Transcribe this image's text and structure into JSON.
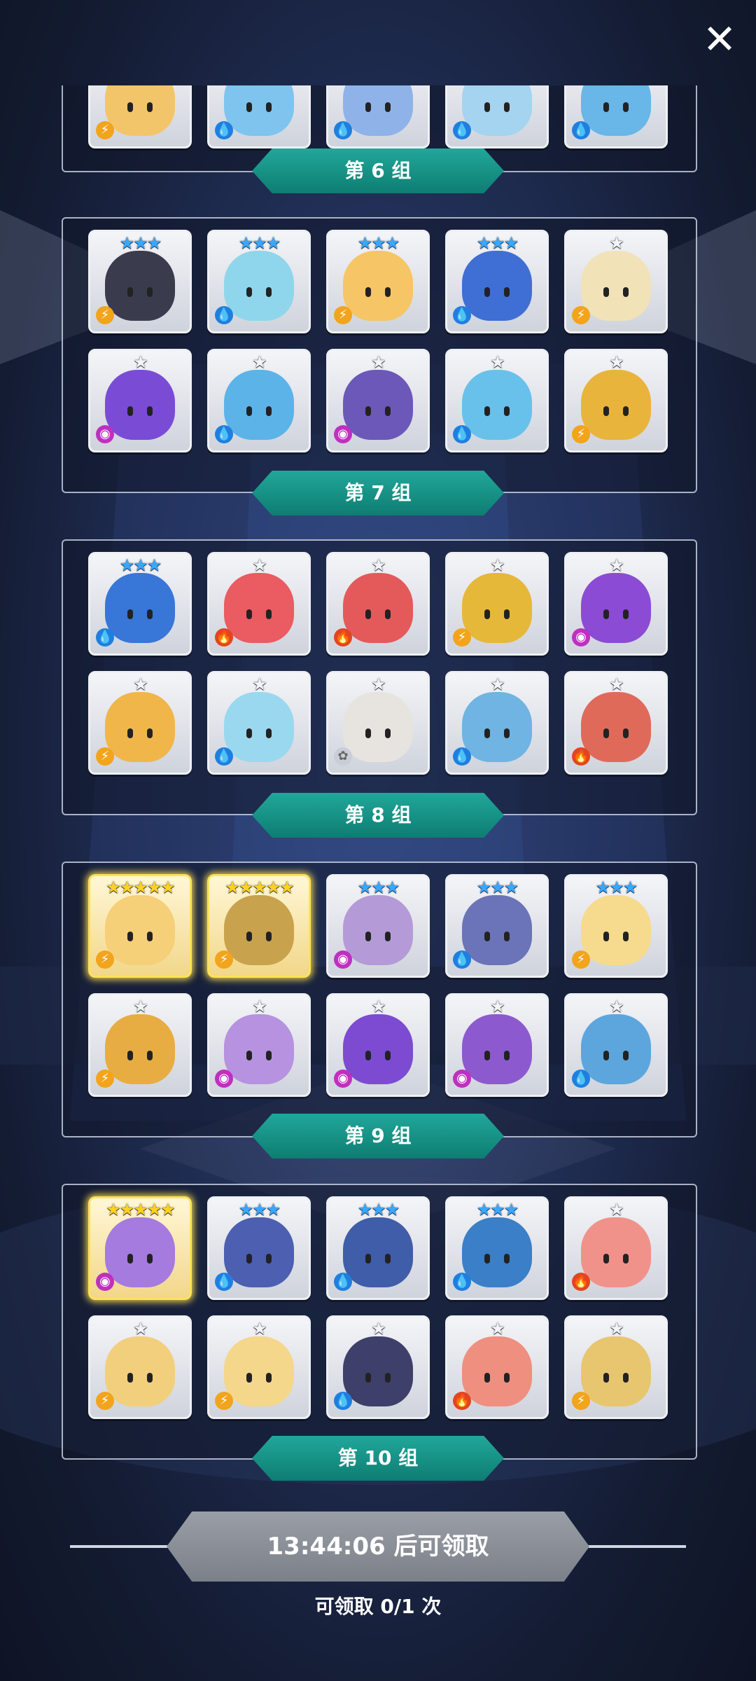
{
  "close_label": "✕",
  "groups": [
    {
      "label": "第 6 组"
    },
    {
      "label": "第 7 组"
    },
    {
      "label": "第 8 组"
    },
    {
      "label": "第 9 组"
    },
    {
      "label": "第 10 组"
    }
  ],
  "cards": {
    "partial_row": [
      {
        "element": "thunder",
        "color": "#f3c56a",
        "stars": 0
      },
      {
        "element": "water",
        "color": "#7ec4ee",
        "stars": 0
      },
      {
        "element": "water",
        "color": "#8fb3e8",
        "stars": 0
      },
      {
        "element": "water",
        "color": "#a4d4ef",
        "stars": 0
      },
      {
        "element": "water",
        "color": "#69b6e8",
        "stars": 0
      }
    ],
    "group7": [
      {
        "element": "thunder",
        "color": "#3b3b4e",
        "stars": 3,
        "tier": "blue",
        "name": "witch-hat-blonde"
      },
      {
        "element": "water",
        "color": "#8fd6ec",
        "stars": 3,
        "tier": "blue",
        "name": "blue-hair-girl"
      },
      {
        "element": "thunder",
        "color": "#f6c565",
        "stars": 3,
        "tier": "blue",
        "name": "yellow-beast"
      },
      {
        "element": "water",
        "color": "#3f6fd4",
        "stars": 3,
        "tier": "blue",
        "name": "crowned-king"
      },
      {
        "element": "thunder",
        "color": "#f1e2b8",
        "stars": 1,
        "tier": "silver",
        "name": "bandaged-mummy"
      },
      {
        "element": "dark",
        "color": "#7a4cd6",
        "stars": 1,
        "tier": "silver",
        "name": "purple-ghost"
      },
      {
        "element": "water",
        "color": "#5cb3e8",
        "stars": 1,
        "tier": "silver",
        "name": "blue-cactus"
      },
      {
        "element": "dark",
        "color": "#6c58b8",
        "stars": 1,
        "tier": "silver",
        "name": "purple-knight"
      },
      {
        "element": "water",
        "color": "#68c1ea",
        "stars": 1,
        "tier": "silver",
        "name": "blue-imp"
      },
      {
        "element": "thunder",
        "color": "#e9b43c",
        "stars": 1,
        "tier": "silver",
        "name": "bandaged-yellow"
      }
    ],
    "group8": [
      {
        "element": "water",
        "color": "#3876d8",
        "stars": 3,
        "tier": "blue",
        "name": "clock-gear"
      },
      {
        "element": "fire",
        "color": "#ea5b62",
        "stars": 1,
        "tier": "silver",
        "name": "red-urchin"
      },
      {
        "element": "fire",
        "color": "#e45a5a",
        "stars": 1,
        "tier": "silver",
        "name": "red-tree"
      },
      {
        "element": "thunder",
        "color": "#e6b83a",
        "stars": 1,
        "tier": "silver",
        "name": "sunflower-chomper"
      },
      {
        "element": "dark",
        "color": "#8b4bd4",
        "stars": 1,
        "tier": "silver",
        "name": "purple-chomper"
      },
      {
        "element": "thunder",
        "color": "#f0b64a",
        "stars": 1,
        "tier": "silver",
        "name": "yellow-skull"
      },
      {
        "element": "water",
        "color": "#9ad8ef",
        "stars": 1,
        "tier": "silver",
        "name": "flower-girl-blue"
      },
      {
        "element": "light",
        "color": "#e7e4e0",
        "stars": 1,
        "tier": "silver",
        "name": "flower-girl-white"
      },
      {
        "element": "water",
        "color": "#6fb4e2",
        "stars": 1,
        "tier": "silver",
        "name": "winged-knight"
      },
      {
        "element": "fire",
        "color": "#e06a5a",
        "stars": 1,
        "tier": "silver",
        "name": "red-totem"
      }
    ],
    "group9": [
      {
        "element": "thunder",
        "color": "#f6cf79",
        "stars": 5,
        "tier": "gold",
        "name": "golden-girl"
      },
      {
        "element": "thunder",
        "color": "#c9a24e",
        "stars": 5,
        "tier": "gold",
        "name": "golden-golem"
      },
      {
        "element": "dark",
        "color": "#b59ad8",
        "stars": 3,
        "tier": "blue",
        "name": "purple-priestess"
      },
      {
        "element": "water",
        "color": "#6b74b8",
        "stars": 3,
        "tier": "blue",
        "name": "skull-witch"
      },
      {
        "element": "thunder",
        "color": "#f6db8e",
        "stars": 3,
        "tier": "blue",
        "name": "blonde-princess"
      },
      {
        "element": "thunder",
        "color": "#e7ad42",
        "stars": 1,
        "tier": "silver",
        "name": "yellow-tree"
      },
      {
        "element": "dark",
        "color": "#b692e0",
        "stars": 1,
        "tier": "silver",
        "name": "purple-mage"
      },
      {
        "element": "dark",
        "color": "#7c4bd2",
        "stars": 1,
        "tier": "silver",
        "name": "purple-witch"
      },
      {
        "element": "dark",
        "color": "#8d59cf",
        "stars": 1,
        "tier": "silver",
        "name": "horned-demon"
      },
      {
        "element": "water",
        "color": "#5ca6dd",
        "stars": 1,
        "tier": "silver",
        "name": "blue-totem"
      }
    ],
    "group10": [
      {
        "element": "dark",
        "color": "#a67be0",
        "stars": 5,
        "tier": "gold",
        "name": "purple-brute"
      },
      {
        "element": "water",
        "color": "#4c5fb0",
        "stars": 3,
        "tier": "blue",
        "name": "dark-prince"
      },
      {
        "element": "water",
        "color": "#3f5da8",
        "stars": 3,
        "tier": "blue",
        "name": "blue-ninja"
      },
      {
        "element": "water",
        "color": "#3a7fc8",
        "stars": 3,
        "tier": "blue",
        "name": "cyclops-scythe"
      },
      {
        "element": "fire",
        "color": "#f0928a",
        "stars": 1,
        "tier": "silver",
        "name": "red-hat-girl"
      },
      {
        "element": "thunder",
        "color": "#f2cf7c",
        "stars": 1,
        "tier": "silver",
        "name": "blonde-warrior"
      },
      {
        "element": "thunder",
        "color": "#f4d78a",
        "stars": 1,
        "tier": "silver",
        "name": "fox-girl"
      },
      {
        "element": "water",
        "color": "#3e3f6a",
        "stars": 1,
        "tier": "silver",
        "name": "dark-hair-girl"
      },
      {
        "element": "fire",
        "color": "#ef8f7f",
        "stars": 1,
        "tier": "silver",
        "name": "red-helm-girl"
      },
      {
        "element": "thunder",
        "color": "#e8c670",
        "stars": 1,
        "tier": "silver",
        "name": "golden-horns"
      }
    ]
  },
  "timer": {
    "label": "13:44:06 后可领取"
  },
  "claim": {
    "label": "可领取 0/1 次"
  }
}
